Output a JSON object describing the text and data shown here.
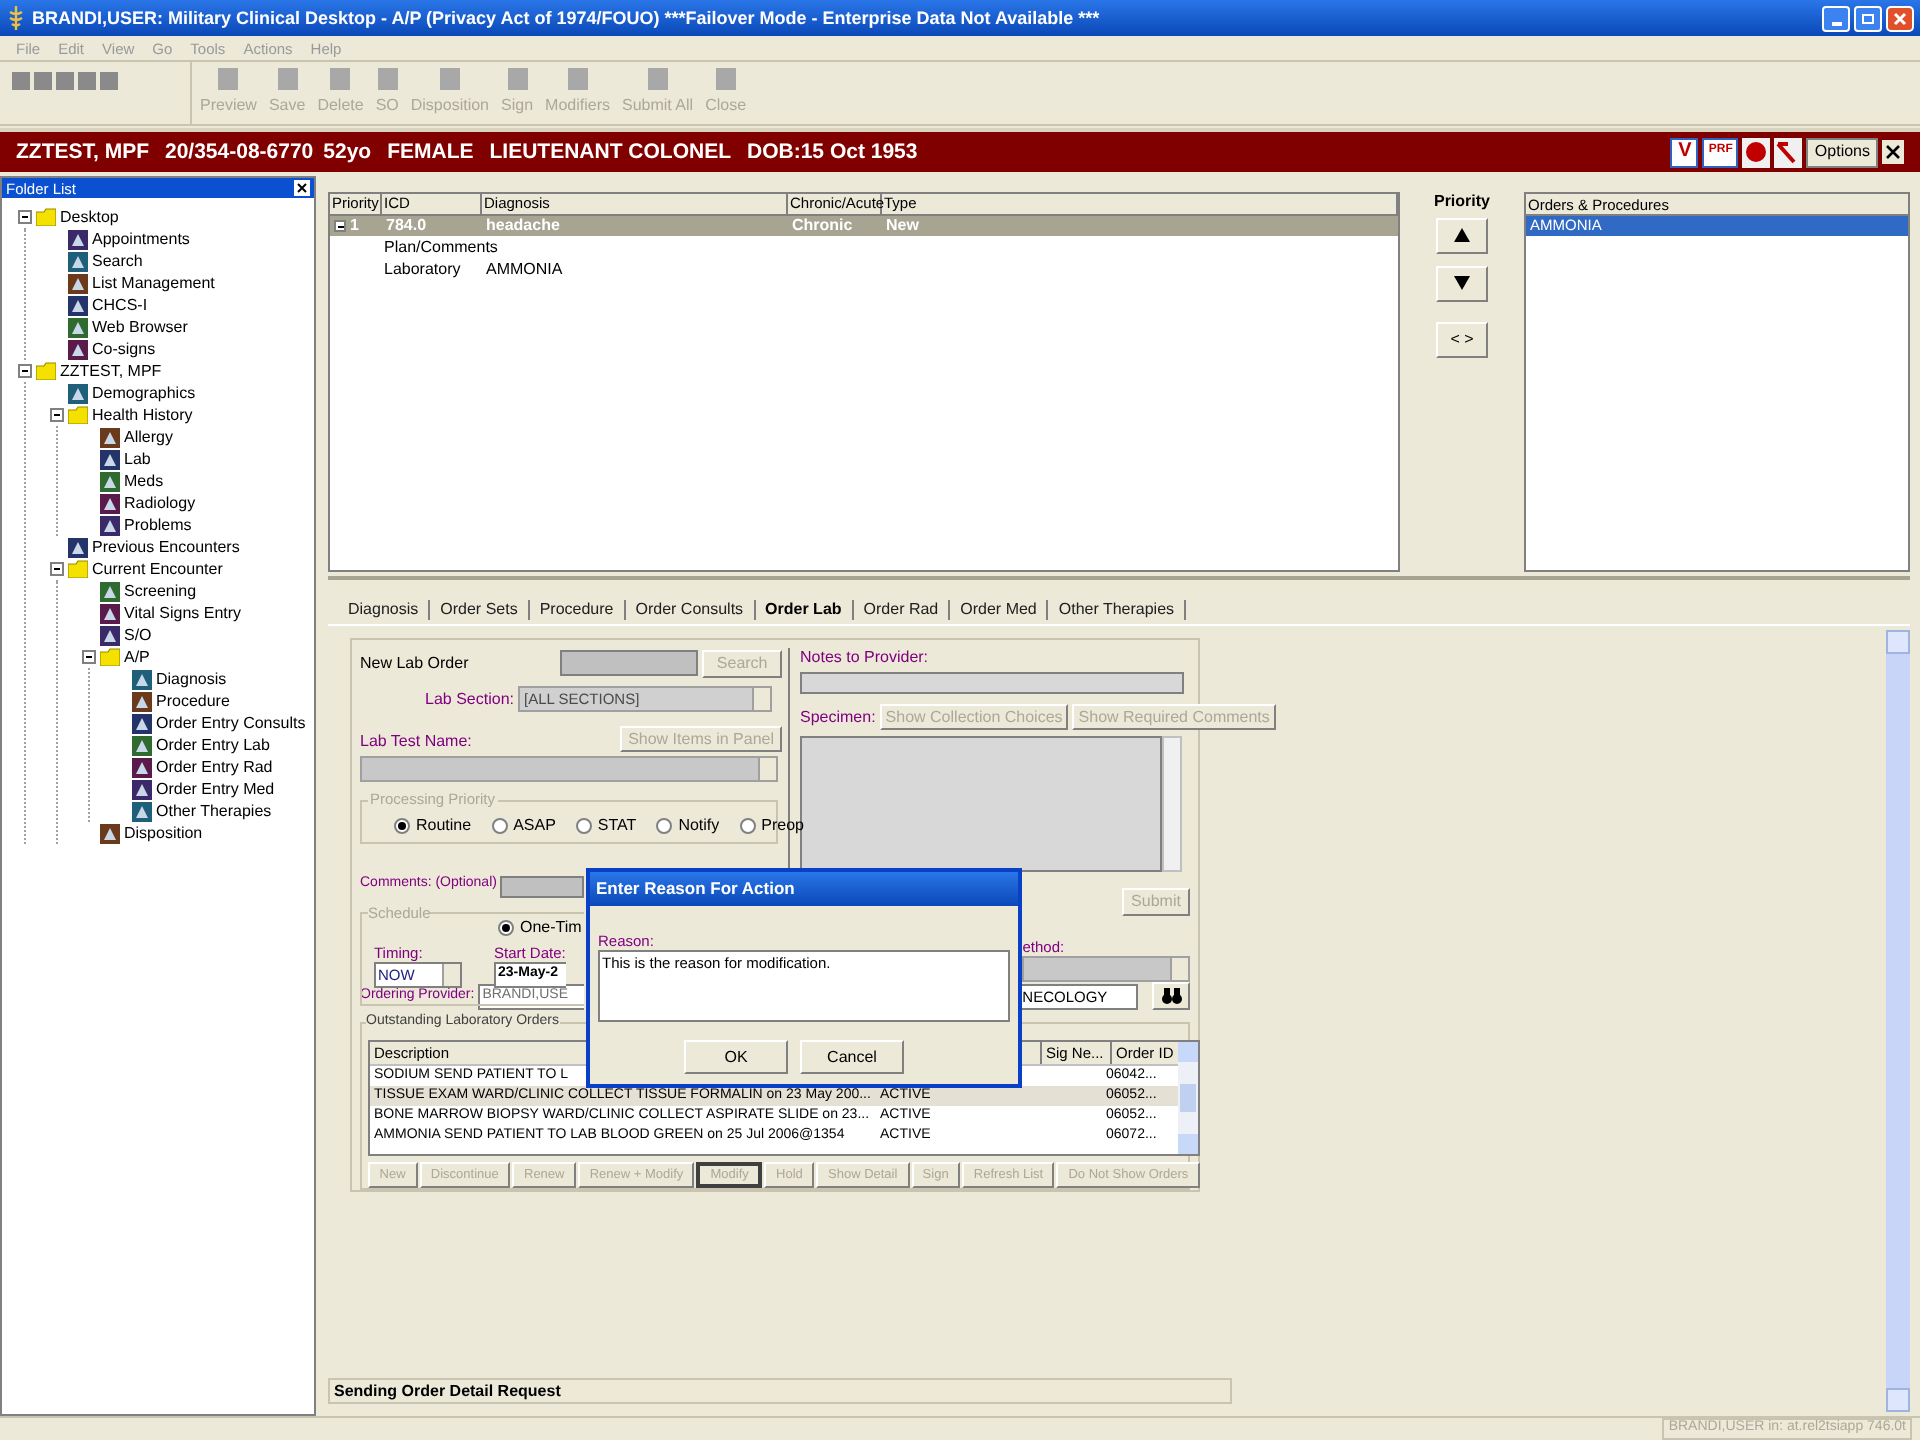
{
  "window": {
    "title": "BRANDI,USER: Military Clinical Desktop - A/P (Privacy Act of 1974/FOUO) ***Failover Mode - Enterprise Data Not Available ***"
  },
  "menu": [
    "File",
    "Edit",
    "View",
    "Go",
    "Tools",
    "Actions",
    "Help"
  ],
  "toolbar": [
    {
      "label": "Preview",
      "disabled": true
    },
    {
      "label": "Save",
      "disabled": true
    },
    {
      "label": "Delete",
      "disabled": true
    },
    {
      "label": "SO",
      "disabled": true
    },
    {
      "label": "Disposition",
      "disabled": true
    },
    {
      "label": "Sign",
      "disabled": true
    },
    {
      "label": "Modifiers",
      "disabled": true
    },
    {
      "label": "Submit All",
      "disabled": true
    },
    {
      "label": "Close",
      "disabled": true
    }
  ],
  "patient_bar": {
    "name": "ZZTEST, MPF",
    "ssn": "20/354-08-6770",
    "age": "52yo",
    "sex": "FEMALE",
    "rank": "LIEUTENANT COLONEL",
    "dob": "DOB:15 Oct 1953",
    "badges": [
      "V",
      "PRF"
    ],
    "options_button": "Options"
  },
  "folder_list": {
    "title": "Folder List",
    "tree": [
      {
        "label": "Desktop",
        "kind": "folder",
        "expanded": true,
        "children": [
          {
            "label": "Appointments",
            "kind": "module"
          },
          {
            "label": "Search",
            "kind": "module"
          },
          {
            "label": "List Management",
            "kind": "module"
          },
          {
            "label": "CHCS-I",
            "kind": "module"
          },
          {
            "label": "Web Browser",
            "kind": "module"
          },
          {
            "label": "Co-signs",
            "kind": "module"
          }
        ]
      },
      {
        "label": "ZZTEST, MPF",
        "kind": "folder",
        "expanded": true,
        "children": [
          {
            "label": "Demographics",
            "kind": "module"
          },
          {
            "label": "Health History",
            "kind": "folder",
            "expanded": true,
            "children": [
              {
                "label": "Allergy",
                "kind": "module"
              },
              {
                "label": "Lab",
                "kind": "module"
              },
              {
                "label": "Meds",
                "kind": "module"
              },
              {
                "label": "Radiology",
                "kind": "module"
              },
              {
                "label": "Problems",
                "kind": "module"
              }
            ]
          },
          {
            "label": "Previous Encounters",
            "kind": "module"
          },
          {
            "label": "Current Encounter",
            "kind": "folder",
            "expanded": true,
            "children": [
              {
                "label": "Screening",
                "kind": "module"
              },
              {
                "label": "Vital Signs Entry",
                "kind": "module"
              },
              {
                "label": "S/O",
                "kind": "module"
              },
              {
                "label": "A/P",
                "kind": "folder",
                "expanded": true,
                "children": [
                  {
                    "label": "Diagnosis",
                    "kind": "module"
                  },
                  {
                    "label": "Procedure",
                    "kind": "module"
                  },
                  {
                    "label": "Order Entry Consults",
                    "kind": "module"
                  },
                  {
                    "label": "Order Entry Lab",
                    "kind": "module"
                  },
                  {
                    "label": "Order Entry Rad",
                    "kind": "module"
                  },
                  {
                    "label": "Order Entry Med",
                    "kind": "module"
                  },
                  {
                    "label": "Other Therapies",
                    "kind": "module"
                  }
                ]
              },
              {
                "label": "Disposition",
                "kind": "module"
              }
            ]
          }
        ]
      }
    ]
  },
  "diagnosis_grid": {
    "columns": [
      "Priority",
      "ICD",
      "Diagnosis",
      "Chronic/Acute",
      "Type"
    ],
    "rows": [
      {
        "priority": "1",
        "icd": "784.0",
        "diagnosis": "headache",
        "chronic_acute": "Chronic",
        "type": "New",
        "selected": true,
        "expanded": true,
        "children": [
          {
            "label": "Plan/Comments"
          },
          {
            "label": "Laboratory",
            "value": "AMMONIA"
          }
        ]
      }
    ]
  },
  "priority_panel": {
    "title": "Priority",
    "swap_button": "< >"
  },
  "orders_procedures": {
    "title": "Orders & Procedures",
    "items": [
      {
        "label": "AMMONIA",
        "selected": true
      }
    ]
  },
  "tabs": [
    {
      "label": "Diagnosis",
      "selected": false
    },
    {
      "label": "Order Sets",
      "selected": false
    },
    {
      "label": "Procedure",
      "selected": false
    },
    {
      "label": "Order Consults",
      "selected": false
    },
    {
      "label": "Order Lab",
      "selected": true
    },
    {
      "label": "Order Rad",
      "selected": false
    },
    {
      "label": "Order Med",
      "selected": false
    },
    {
      "label": "Other Therapies",
      "selected": false
    }
  ],
  "lab_order": {
    "title": "New Lab Order",
    "search_button": {
      "label": "Search",
      "disabled": true
    },
    "lab_section": {
      "label": "Lab Section:",
      "value": "[ALL SECTIONS]"
    },
    "lab_test": {
      "label": "Lab Test Name:",
      "button": {
        "label": "Show Items in Panel",
        "disabled": true
      }
    },
    "processing_priority": {
      "title": "Processing Priority",
      "options": [
        {
          "label": "Routine",
          "selected": true
        },
        {
          "label": "ASAP",
          "selected": false
        },
        {
          "label": "STAT",
          "selected": false
        },
        {
          "label": "Notify",
          "selected": false
        },
        {
          "label": "Preop",
          "selected": false
        }
      ]
    },
    "notes": {
      "label": "Notes to Provider:"
    },
    "specimen": {
      "label": "Specimen:",
      "buttons": [
        {
          "label": "Show Collection Choices",
          "disabled": true
        },
        {
          "label": "Show Required Comments",
          "disabled": true
        }
      ]
    },
    "comments": {
      "label": "Comments: (Optional)"
    },
    "submit_button": {
      "label": "Submit",
      "disabled": true
    },
    "schedule": {
      "title": "Schedule",
      "frequency": {
        "label": "One-Tim",
        "selected": true
      },
      "timing": {
        "label": "Timing:",
        "value": "NOW"
      },
      "start_date": {
        "label": "Start Date:",
        "value": "23-May-2"
      },
      "method_label": "ethod:"
    },
    "ordering_provider": {
      "label": "Ordering Provider:",
      "value": "BRANDI,USE",
      "clinic": "NECOLOGY"
    },
    "outstanding": {
      "title": "Outstanding Laboratory Orders",
      "columns": [
        "Description",
        "Sig Ne...",
        "Order ID"
      ],
      "rows": [
        {
          "description": "SODIUM SEND PATIENT TO L",
          "order_id": "06042...",
          "selected": false
        },
        {
          "description": "TISSUE EXAM WARD/CLINIC COLLECT TISSUE FORMALIN on 23 May 200...",
          "status": "ACTIVE",
          "order_id": "06052...",
          "selected": true
        },
        {
          "description": "BONE MARROW BIOPSY WARD/CLINIC COLLECT ASPIRATE SLIDE on 23...",
          "status": "ACTIVE",
          "order_id": "06052...",
          "selected": false
        },
        {
          "description": "AMMONIA SEND PATIENT TO LAB BLOOD GREEN on 25 Jul 2006@1354",
          "status": "ACTIVE",
          "order_id": "06072...",
          "selected": false
        }
      ],
      "buttons": [
        {
          "label": "New",
          "disabled": true,
          "focused": false
        },
        {
          "label": "Discontinue",
          "disabled": true,
          "focused": false
        },
        {
          "label": "Renew",
          "disabled": true,
          "focused": false
        },
        {
          "label": "Renew + Modify",
          "disabled": true,
          "focused": false
        },
        {
          "label": "Modify",
          "disabled": true,
          "focused": true
        },
        {
          "label": "Hold",
          "disabled": true,
          "focused": false
        },
        {
          "label": "Show Detail",
          "disabled": true,
          "focused": false
        },
        {
          "label": "Sign",
          "disabled": true,
          "focused": false
        },
        {
          "label": "Refresh List",
          "disabled": true,
          "focused": false
        },
        {
          "label": "Do Not Show Orders",
          "disabled": true,
          "focused": false
        }
      ]
    }
  },
  "dialog": {
    "title": "Enter Reason For Action",
    "label": "Reason:",
    "value": "This is the reason for modification.",
    "buttons": [
      "OK",
      "Cancel"
    ]
  },
  "status_message": "Sending Order Detail Request",
  "status_bar": "BRANDI,USER in: at.rel2tsiapp 746.0t"
}
